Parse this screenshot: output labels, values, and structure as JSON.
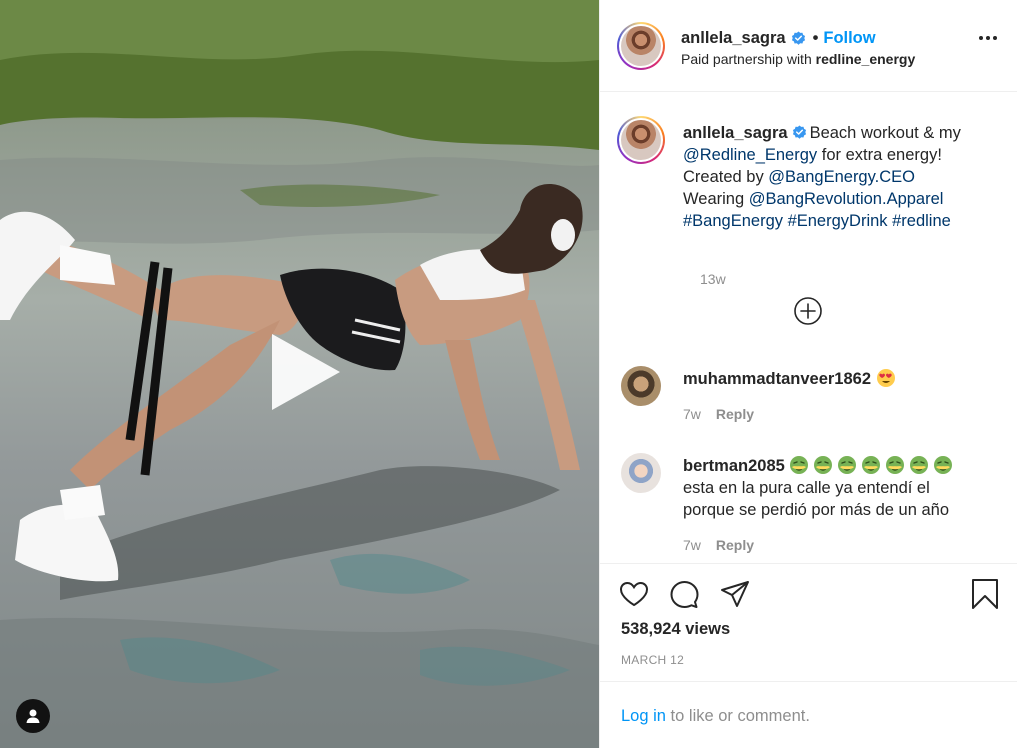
{
  "post": {
    "username": "anllela_sagra",
    "follow_label": "Follow",
    "dot": "•",
    "paid_partnership_prefix": "Paid partnership with",
    "partner": "redline_energy"
  },
  "caption": {
    "username": "anllela_sagra",
    "line1_text": "Beach workout & my",
    "line2_mention": "@Redline_Energy",
    "line2_text": " for extra energy!",
    "line3_prefix": "Created by ",
    "line3_mention": "@BangEnergy.CEO",
    "line4_prefix": "Wearing ",
    "line4_mention": "@BangRevolution.Apparel",
    "line5_tags": "#BangEnergy #EnergyDrink #redline",
    "time": "13w"
  },
  "comments": [
    {
      "username": "muhammadtanveer1862",
      "emoji": "heart-eyes-emoji",
      "time": "7w",
      "reply_label": "Reply"
    },
    {
      "username": "bertman2085",
      "emoji": "nauseated-face-emoji",
      "emoji_count": 7,
      "text_line1": "esta en la pura calle ya entendí el",
      "text_line2": "porque se perdió por más de un año",
      "time": "7w",
      "reply_label": "Reply"
    }
  ],
  "stats": {
    "views": "538,924 views",
    "date": "MARCH 12"
  },
  "login": {
    "link": "Log in",
    "rest": " to like or comment."
  },
  "icons": {
    "more": "more-options-icon",
    "verified": "verified-badge-icon",
    "load_more": "plus-circle-icon",
    "like": "heart-icon",
    "comment": "comment-icon",
    "share": "paper-plane-icon",
    "save": "bookmark-icon",
    "play": "play-icon",
    "tags": "user-tag-icon"
  },
  "colors": {
    "link_blue": "#0095f6",
    "mention_blue": "#00376b",
    "muted": "#8e8e8e",
    "text": "#262626"
  }
}
